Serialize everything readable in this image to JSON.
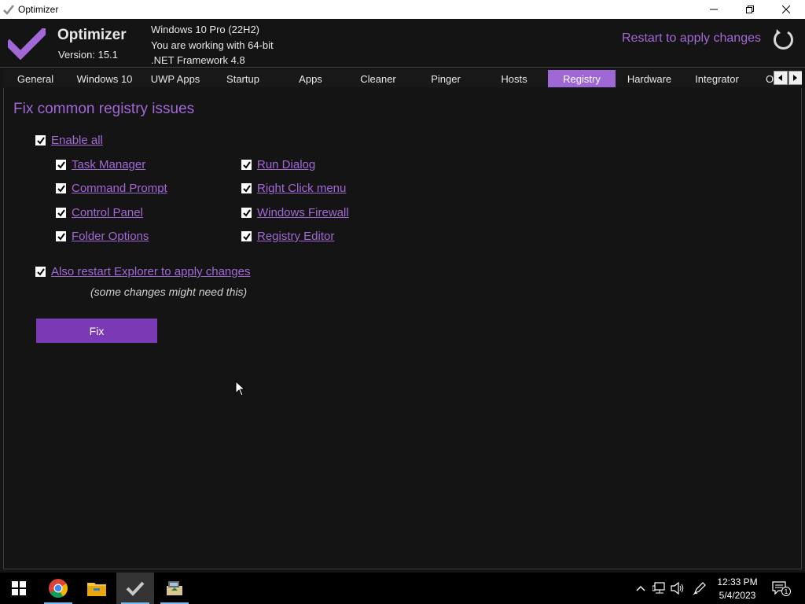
{
  "window": {
    "title": "Optimizer"
  },
  "header": {
    "app_name": "Optimizer",
    "version": "Version: 15.1",
    "sysinfo": [
      "Windows 10 Pro (22H2)",
      "You are working with 64-bit",
      ".NET Framework 4.8"
    ],
    "restart_label": "Restart to apply changes"
  },
  "tabs": [
    {
      "label": "General"
    },
    {
      "label": "Windows 10"
    },
    {
      "label": "UWP Apps"
    },
    {
      "label": "Startup"
    },
    {
      "label": "Apps"
    },
    {
      "label": "Cleaner"
    },
    {
      "label": "Pinger"
    },
    {
      "label": "Hosts"
    },
    {
      "label": "Registry"
    },
    {
      "label": "Hardware"
    },
    {
      "label": "Integrator"
    },
    {
      "label": "O"
    }
  ],
  "active_tab": "Registry",
  "registry": {
    "title": "Fix common registry issues",
    "enable_all": {
      "label": "Enable all",
      "checked": true
    },
    "options_left": [
      {
        "label": "Task Manager",
        "checked": true
      },
      {
        "label": "Command Prompt",
        "checked": true
      },
      {
        "label": "Control Panel",
        "checked": true
      },
      {
        "label": "Folder Options",
        "checked": true
      }
    ],
    "options_right": [
      {
        "label": "Run Dialog",
        "checked": true
      },
      {
        "label": "Right Click menu",
        "checked": true
      },
      {
        "label": "Windows Firewall",
        "checked": true
      },
      {
        "label": "Registry Editor",
        "checked": true
      }
    ],
    "restart_explorer": {
      "label": "Also restart Explorer to apply changes",
      "checked": true
    },
    "hint": "(some changes might need this)",
    "fix_button": "Fix"
  },
  "taskbar": {
    "time": "12:33 PM",
    "date": "5/4/2023",
    "notification_count": "1",
    "apps": [
      "start-icon",
      "chrome-icon",
      "file-explorer-icon",
      "optimizer-icon",
      "installer-icon"
    ]
  },
  "colors": {
    "accent": "#a269d6",
    "active_tab": "#9f66d6",
    "button": "#7a3ab6",
    "background": "#141414"
  }
}
